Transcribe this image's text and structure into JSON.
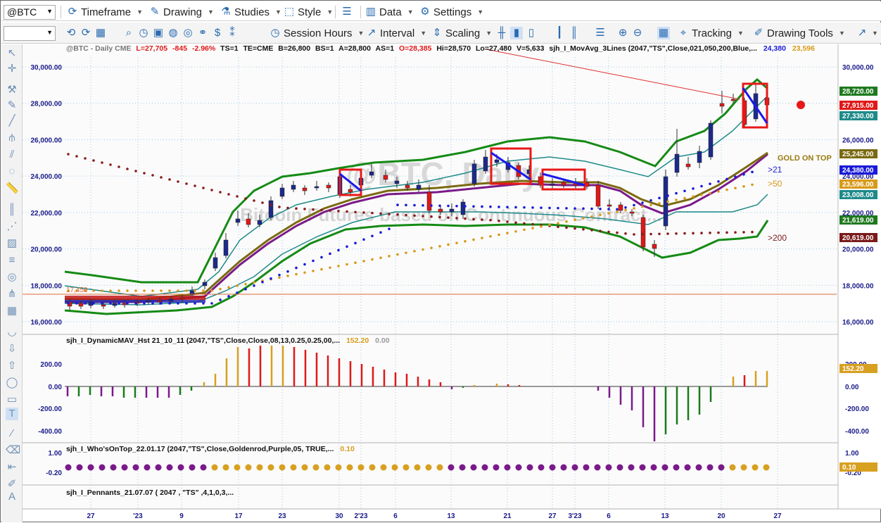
{
  "toolbar1": {
    "symbol": "@BTC",
    "timeframe": "Timeframe",
    "drawing": "Drawing",
    "studies": "Studies",
    "style": "Style",
    "data": "Data",
    "settings": "Settings"
  },
  "toolbar2": {
    "session_hours": "Session Hours",
    "interval": "Interval",
    "scaling": "Scaling",
    "tracking": "Tracking",
    "drawing_tools": "Drawing Tools"
  },
  "header": {
    "symbol_info": "@BTC - Daily  CME",
    "last": "L=27,705",
    "change": "-845",
    "pct": "-2.96%",
    "ts": "TS=1",
    "te": "TE=CME",
    "bid": "B=26,800",
    "bs": "BS=1",
    "ask": "A=28,800",
    "as": "AS=1",
    "open": "O=28,385",
    "hi": "Hi=28,570",
    "lo": "Lo=27,480",
    "vol": "V=5,633",
    "study": "sjh_I_MovAvg_3Lines (2047,\"TS\",Close,021,050,200,Blue,...",
    "study_v1": "24,380",
    "study_v2": "23,596"
  },
  "watermark": {
    "title": "@BTC, Daily",
    "subtitle": "Bitcoin Futures based on Continuous Contract..."
  },
  "price_axis": {
    "ticks": [
      "30,000.00",
      "28,000.00",
      "26,000.00",
      "24,000.00",
      "22,000.00",
      "20,000.00",
      "18,000.00",
      "16,000.00"
    ],
    "tags": [
      {
        "text": "28,720.00",
        "color": "#1f7a1f"
      },
      {
        "text": "27,915.00",
        "color": "#e01818"
      },
      {
        "text": "27,330.00",
        "color": "#1f8a8a"
      },
      {
        "text": "25,245.00",
        "color": "#7a6a10"
      },
      {
        "text": "24,380.00",
        "color": "#1a1adb"
      },
      {
        "text": "23,596.00",
        "color": "#d89a1a"
      },
      {
        "text": "23,008.00",
        "color": "#1f8a8a"
      },
      {
        "text": "21,619.00",
        "color": "#1f7a1f"
      },
      {
        "text": "20,619.00",
        "color": "#7a1a1a"
      }
    ],
    "level_label": "17,459"
  },
  "annotations": {
    "gold_on_top": "GOLD ON TOP",
    "ma21": ">21",
    "ma50": ">50",
    "ma200": ">200"
  },
  "subpanel1": {
    "title": "sjh_I_DynamicMAV_Hst 21_10_11 (2047,\"TS\",Close,Close,08,13,0.25,0.25,00,...",
    "v1": "152.20",
    "v2": "0.00",
    "ticks": [
      "200.00",
      "0.00",
      "-200.00",
      "-400.00"
    ],
    "tag": "152.20",
    "right_ticks": [
      "200.00",
      "0.00",
      "-200.00",
      "-400.00"
    ]
  },
  "subpanel2": {
    "title": "sjh_I_Who'sOnTop_22.01.17 (2047,\"TS\",Close,Goldenrod,Purple,05, TRUE,...",
    "v1": "0.10",
    "ticks": [
      "1.00",
      "-0.20"
    ],
    "tag": "0.10",
    "right_ticks": [
      "1.00",
      "-0.20"
    ]
  },
  "subpanel3": {
    "title": "sjh_I_Pennants_21.07.07 ( 2047 , \"TS\" ,4,1,0,3,..."
  },
  "date_axis": [
    "27",
    "'23",
    "9",
    "17",
    "23",
    "30",
    "2'23",
    "6",
    "13",
    "21",
    "27",
    "3'23",
    "6",
    "13",
    "20",
    "27"
  ],
  "colors": {
    "up": "#1c2a8a",
    "down": "#e01818",
    "band_green": "#158a15",
    "teal": "#1f8a8a",
    "olive": "#7a6a10",
    "purple": "#7a1a8a",
    "gold": "#d89a1a",
    "maroon": "#8a1a1a"
  }
}
